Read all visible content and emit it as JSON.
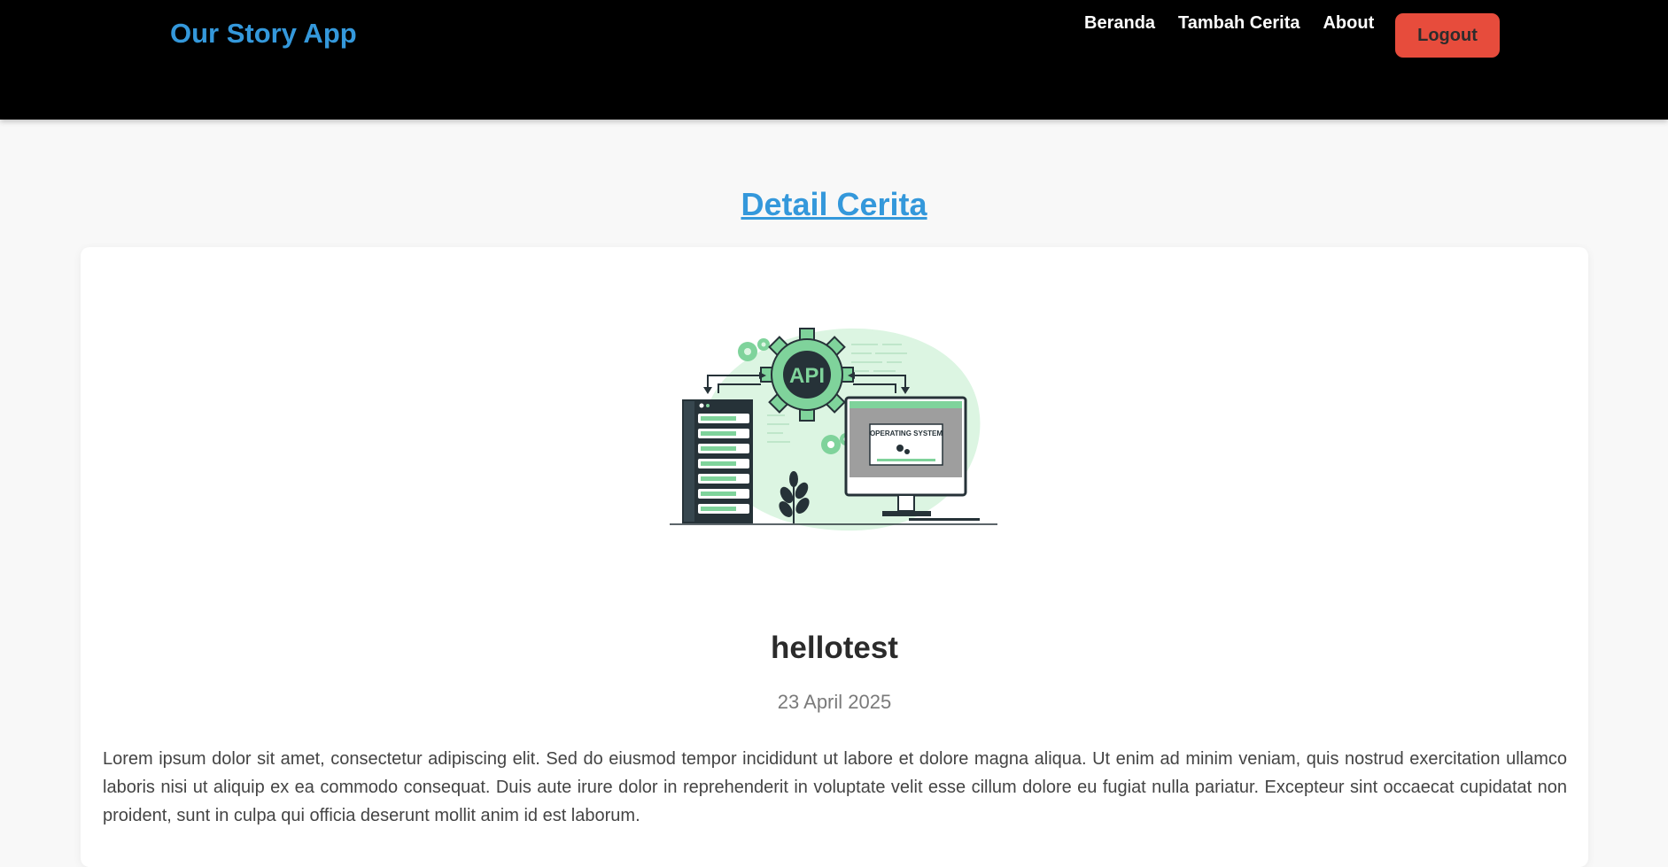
{
  "nav": {
    "brand": "Our Story App",
    "links": [
      "Beranda",
      "Tambah Cerita",
      "About"
    ],
    "logout_label": "Logout"
  },
  "page": {
    "title": "Detail Cerita"
  },
  "story": {
    "image_icon": "api-illustration",
    "image_text": {
      "badge": "API",
      "screen_label": "OPERATING SYSTEM"
    },
    "title": "hellotest",
    "date": "23 April 2025",
    "body": "Lorem ipsum dolor sit amet, consectetur adipiscing elit. Sed do eiusmod tempor incididunt ut labore et dolore magna aliqua. Ut enim ad minim veniam, quis nostrud exercitation ullamco laboris nisi ut aliquip ex ea commodo consequat. Duis aute irure dolor in reprehenderit in voluptate velit esse cillum dolore eu fugiat nulla pariatur. Excepteur sint occaecat cupidatat non proident, sunt in culpa qui officia deserunt mollit anim id est laborum."
  },
  "colors": {
    "navbar_bg": "#000000",
    "brand": "#3498db",
    "logout_bg": "#e74c3c",
    "accent_green": "#7fd39b"
  }
}
